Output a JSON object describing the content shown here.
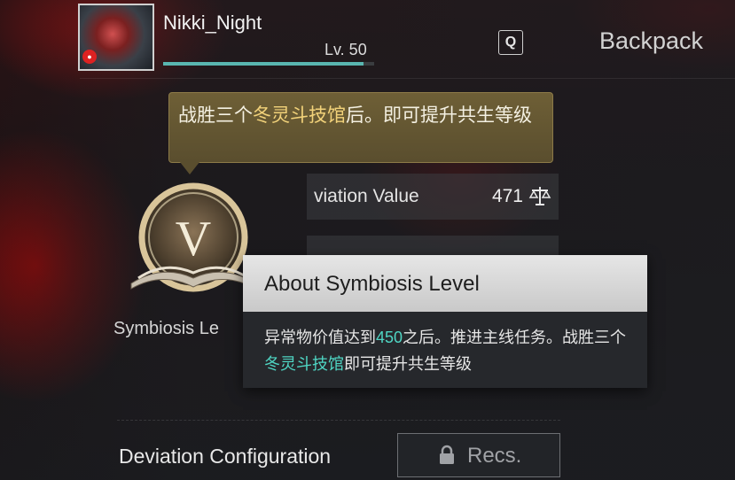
{
  "header": {
    "username": "Nikki_Night",
    "level": "Lv. 50",
    "xp_progress": 0.95,
    "search_key": "Q",
    "backpack_label": "Backpack"
  },
  "tooltip": {
    "text_a": "战胜三个",
    "text_highlight": "冬灵斗技馆",
    "text_b": "后。即可提升共生等级"
  },
  "symbiosis": {
    "emblem_letter": "V",
    "label": "Symbiosis Le"
  },
  "stats": {
    "deviation_label": "viation Value",
    "deviation_value": "471",
    "deviation_icon": "scales-icon"
  },
  "about": {
    "title": "About Symbiosis Level",
    "body_a": "异常物价值达到",
    "body_num": "450",
    "body_b": "之后。推进主线任务。战胜三个",
    "body_highlight": "冬灵斗技馆",
    "body_c": "即可提升共生等级"
  },
  "bottom": {
    "config_label": "Deviation Configuration",
    "recs_label": "Recs.",
    "recs_icon": "lock-icon"
  },
  "colors": {
    "xp_bar": "#59b6b0",
    "highlight_cyan": "#4fd6c4",
    "highlight_gold": "#f2d27a"
  }
}
